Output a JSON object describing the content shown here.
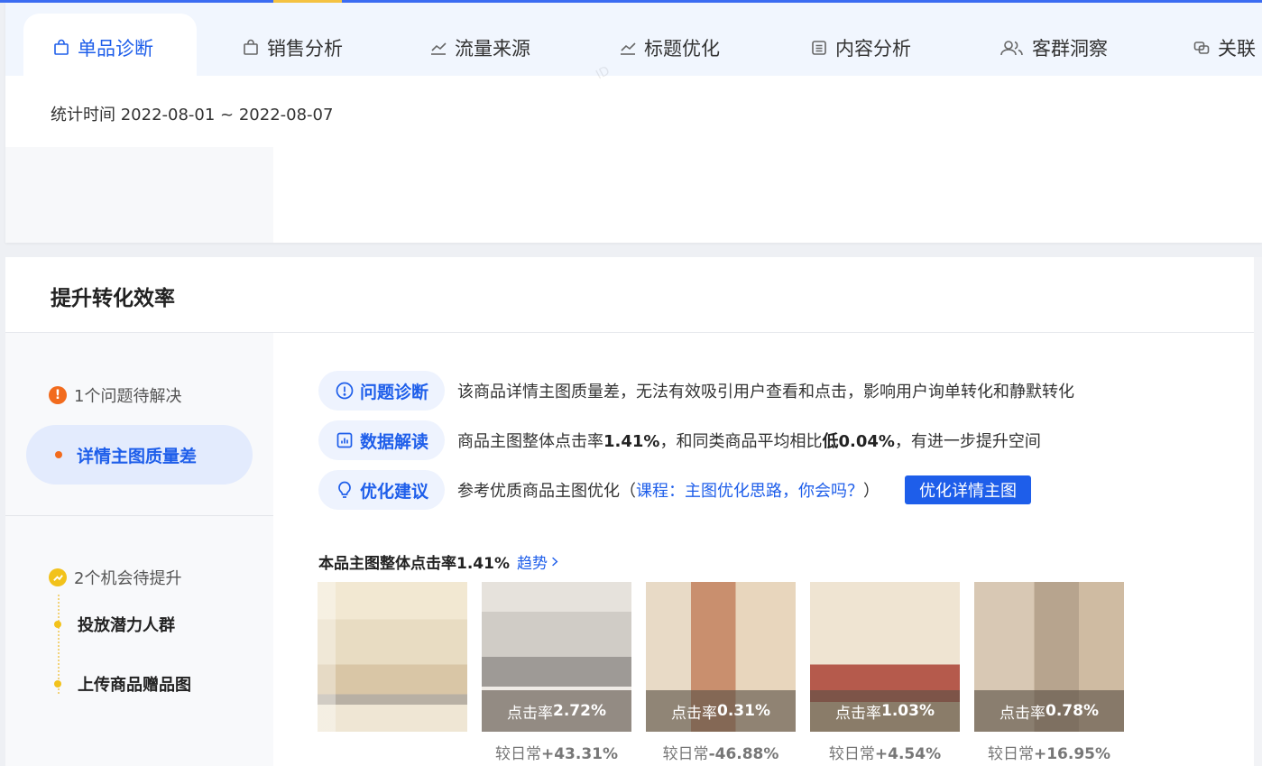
{
  "tabs": [
    {
      "label": "单品诊断",
      "icon": "bag-icon",
      "active": true
    },
    {
      "label": "销售分析",
      "icon": "bag-icon",
      "active": false
    },
    {
      "label": "流量来源",
      "icon": "line-chart-icon",
      "active": false
    },
    {
      "label": "标题优化",
      "icon": "line-chart-icon",
      "active": false
    },
    {
      "label": "内容分析",
      "icon": "list-doc-icon",
      "active": false
    },
    {
      "label": "客群洞察",
      "icon": "users-icon",
      "active": false
    },
    {
      "label": "关联",
      "icon": "link-icon",
      "active": false
    }
  ],
  "stat_time": "统计时间 2022-08-01 ~ 2022-08-07",
  "section": {
    "title": "提升转化效率"
  },
  "problems": {
    "header": "1个问题待解决",
    "items": [
      "详情主图质量差"
    ]
  },
  "opportunities": {
    "header": "2个机会待提升",
    "items": [
      "投放潜力人群",
      "上传商品赠品图"
    ]
  },
  "diagnosis": {
    "label": "问题诊断",
    "text": "该商品详情主图质量差，无法有效吸引用户查看和点击，影响用户询单转化和静默转化"
  },
  "interpretation": {
    "label": "数据解读",
    "text_before": "商品主图整体点击率",
    "rate": "1.41%",
    "text_mid": "，和同类商品平均相比",
    "compare": "低0.04%",
    "text_after": "，有进一步提升空间"
  },
  "suggestion": {
    "label": "优化建议",
    "text_before": "参考优质商品主图优化（",
    "link": "课程：主图优化思路，你会吗？",
    "text_after": "）",
    "button": "优化详情主图"
  },
  "ctr_summary": {
    "title": "本品主图整体点击率1.41%",
    "trend_link": "趋势"
  },
  "thumbnails": [
    {
      "ctr_label": "",
      "ctr_value": "",
      "delta_label": "",
      "delta_value": "",
      "tone": "#e9dcc4"
    },
    {
      "ctr_label": "点击率",
      "ctr_value": "2.72%",
      "delta_label": "较日常",
      "delta_value": "+43.31%",
      "tone": "#d9d4cc"
    },
    {
      "ctr_label": "点击率",
      "ctr_value": "0.31%",
      "delta_label": "较日常",
      "delta_value": "-46.88%",
      "tone": "#e4cdb2"
    },
    {
      "ctr_label": "点击率",
      "ctr_value": "1.03%",
      "delta_label": "较日常",
      "delta_value": "+4.54%",
      "tone": "#e6d4bc"
    },
    {
      "ctr_label": "点击率",
      "ctr_value": "0.78%",
      "delta_label": "较日常",
      "delta_value": "+16.95%",
      "tone": "#dcc9b4"
    }
  ],
  "colors": {
    "primary": "#1e5eea",
    "warning": "#f26b1d",
    "opportunity": "#f2c21b"
  }
}
